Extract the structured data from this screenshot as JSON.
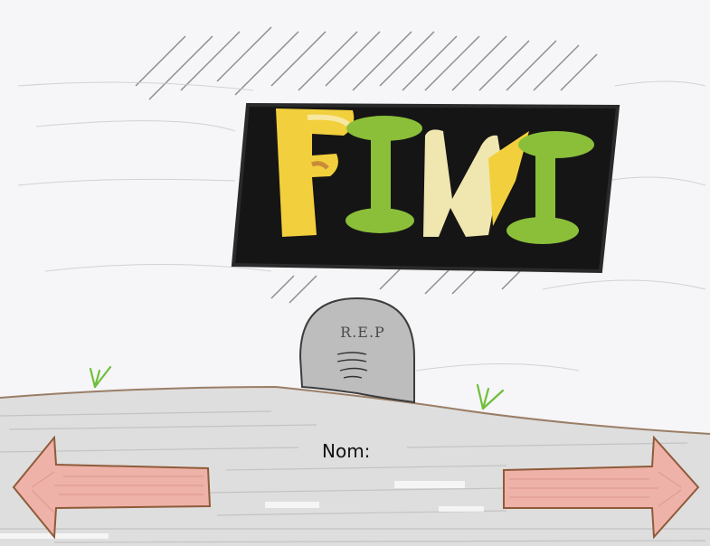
{
  "sign": {
    "title": "FIN",
    "colors": {
      "board": "#141414",
      "letter_f": "#f2cf3c",
      "letter_i": "#8bbf3a",
      "letter_n": "#f0e6b0"
    }
  },
  "tombstone": {
    "inscription": "R.E.P"
  },
  "name_field": {
    "label": "Nom:"
  },
  "navigation": {
    "previous_icon": "arrow-left-icon",
    "next_icon": "arrow-right-icon",
    "arrow_color": "#e9a8a0"
  },
  "colors": {
    "paper": "#f6f5f8",
    "ground": "#dcdcdc",
    "stone": "#bdbdbd",
    "grass": "#6fbf3a"
  }
}
